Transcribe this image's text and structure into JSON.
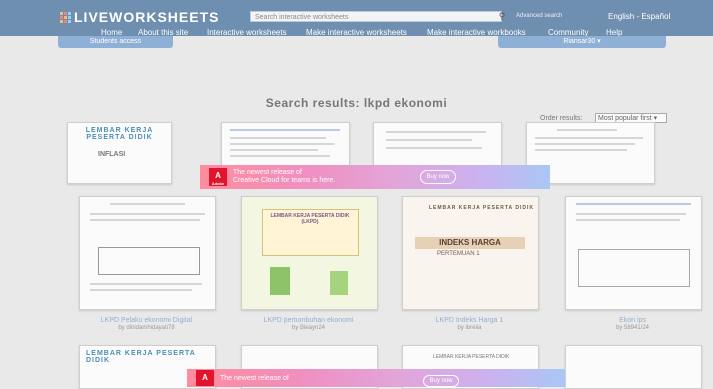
{
  "header": {
    "logo": "LIVEWORKSHEETS",
    "search_placeholder": "Search interactive worksheets",
    "advanced_search": "Advanced search",
    "language": "English - Español",
    "nav": [
      "Home",
      "About this site",
      "Interactive worksheets",
      "Make interactive worksheets",
      "Make interactive workbooks",
      "Community",
      "Help"
    ],
    "students_access": "Students access",
    "user_menu": "Riansar30 ▾"
  },
  "main": {
    "title": "Search results: lkpd ekonomi",
    "order_label": "Order results:",
    "order_value": "Most popular first ▾"
  },
  "ad": {
    "brand": "Adobe",
    "line1": "The newest release of",
    "line2": "Creative Cloud for teams is here.",
    "button": "Buy now"
  },
  "row1": [
    {
      "mini_title": "LEMBAR KERJA PESERTA DIDIK",
      "sub": "INFLASI"
    },
    {
      "mini_title": ""
    },
    {
      "mini_title": ""
    },
    {
      "mini_title": ""
    }
  ],
  "row2": [
    {
      "caption": "LKPD Pelaku ekonomi Digital",
      "by": "by dinidamhidayati78",
      "mini_title": ""
    },
    {
      "caption": "LKPD pertumbuhan ekonomi",
      "by": "by Bleayn24",
      "mini_title": "LEMBAR KERJA PESERTA DIDIK (LKPD)"
    },
    {
      "caption": "LKPD Indeks Harga 1",
      "by": "by ibrelia",
      "mini_title": "LEMBAR KERJA PESERTA DIDIK",
      "banner": "INDEKS HARGA",
      "sub": "PERTEMUAN 1"
    },
    {
      "caption": "Ekon ips",
      "by": "by 58941/24",
      "mini_title": ""
    }
  ],
  "row3": [
    {
      "mini_title": "LEMBAR KERJA PESERTA DIDIK"
    },
    {
      "mini_title": ""
    },
    {
      "mini_title": "LEMBAR KERJA PESERTA DIDIK"
    },
    {
      "mini_title": ""
    }
  ]
}
